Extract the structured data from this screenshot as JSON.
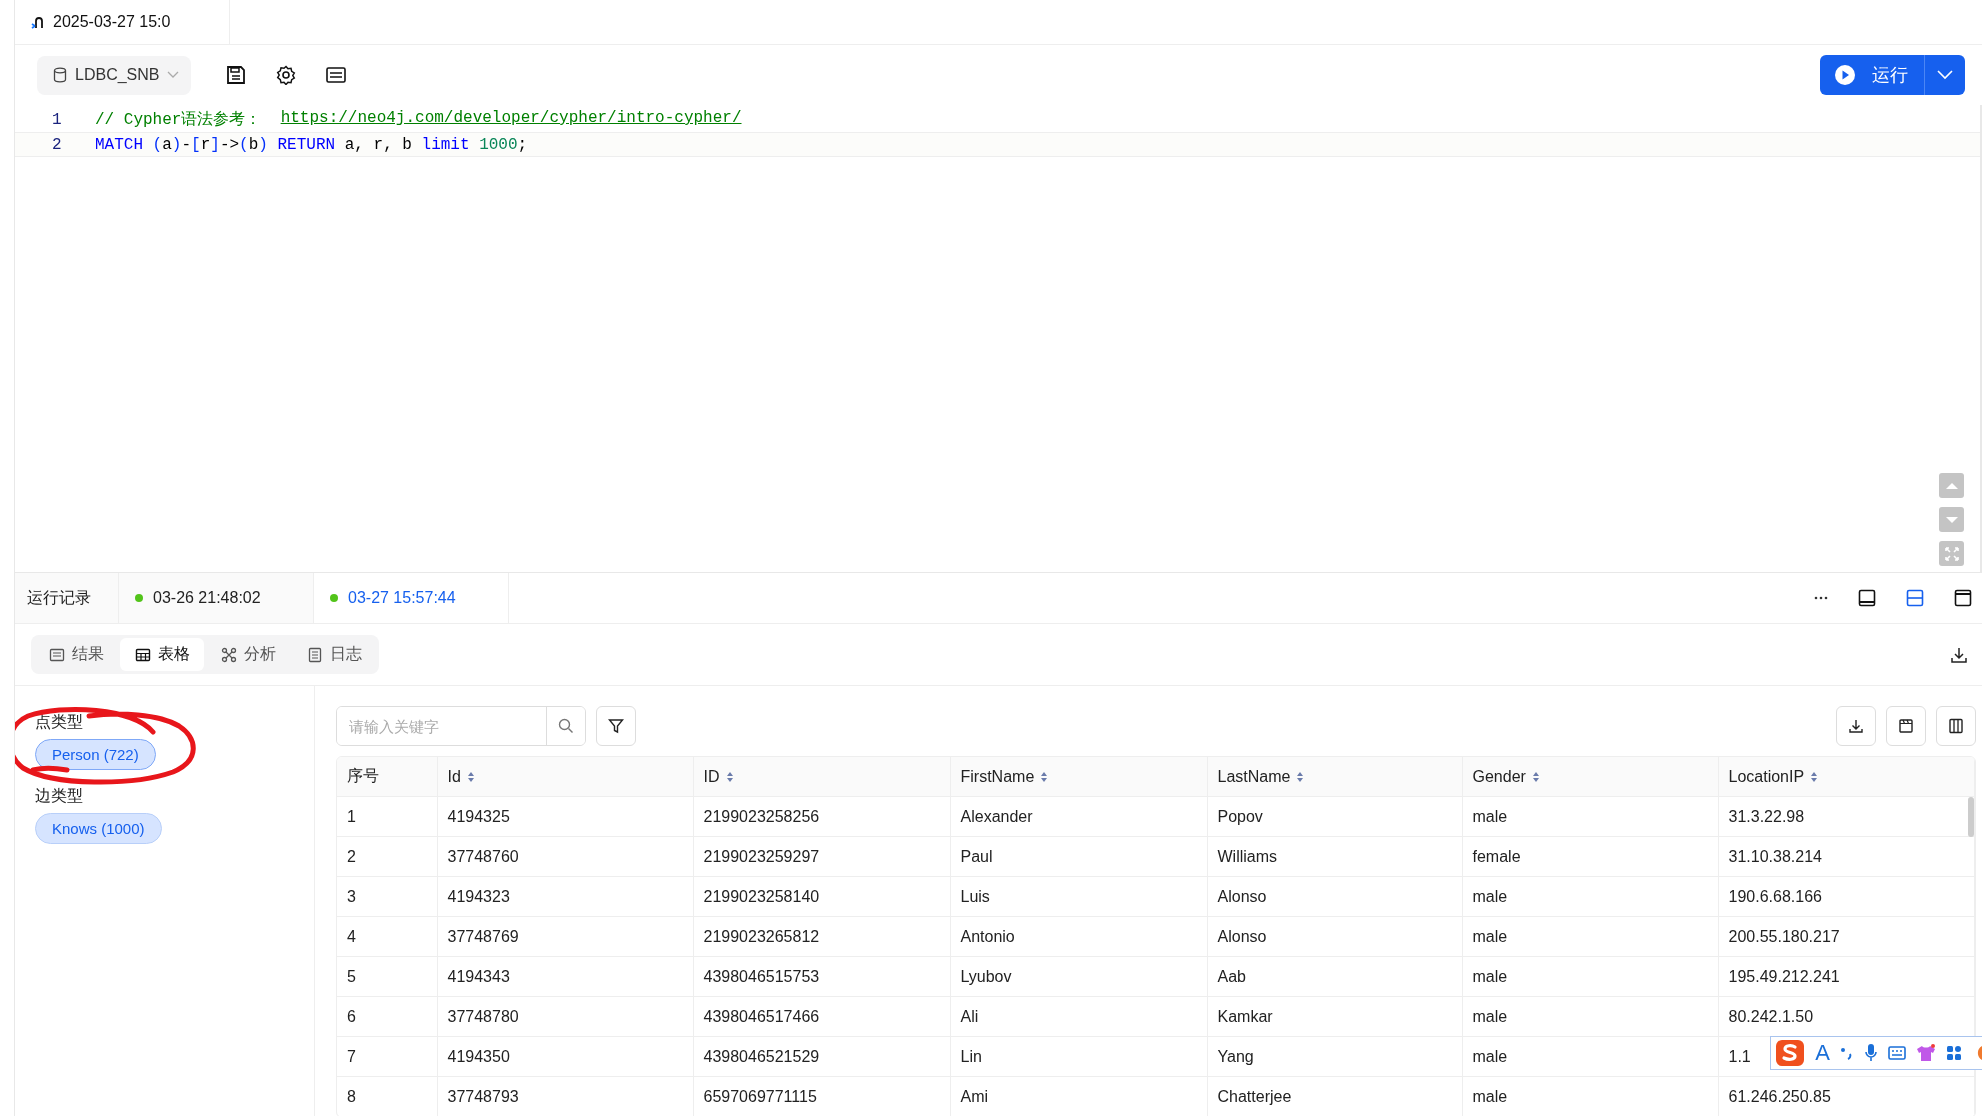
{
  "tab": {
    "title": "2025-03-27 15:0"
  },
  "toolbar": {
    "database": "LDBC_SNB",
    "run_button": "运行"
  },
  "editor": {
    "lines": [
      {
        "number": "1",
        "tokens": [
          {
            "kind": "comment",
            "text": "// Cypher语法参考：  "
          },
          {
            "kind": "link",
            "text": "https://neo4j.com/developer/cypher/intro-cypher/"
          }
        ]
      },
      {
        "number": "2",
        "tokens": [
          {
            "kind": "keyword",
            "text": "MATCH "
          },
          {
            "kind": "bracket",
            "text": "("
          },
          {
            "kind": "plain",
            "text": "a"
          },
          {
            "kind": "bracket",
            "text": ")"
          },
          {
            "kind": "plain",
            "text": "-"
          },
          {
            "kind": "bracket",
            "text": "["
          },
          {
            "kind": "plain",
            "text": "r"
          },
          {
            "kind": "bracket",
            "text": "]"
          },
          {
            "kind": "plain",
            "text": "->"
          },
          {
            "kind": "bracket",
            "text": "("
          },
          {
            "kind": "plain",
            "text": "b"
          },
          {
            "kind": "bracket",
            "text": ")"
          },
          {
            "kind": "keyword",
            "text": " RETURN"
          },
          {
            "kind": "plain",
            "text": " a, r, b "
          },
          {
            "kind": "keyword",
            "text": "limit"
          },
          {
            "kind": "number",
            "text": " 1000"
          },
          {
            "kind": "plain",
            "text": ";"
          }
        ]
      }
    ]
  },
  "history": {
    "label": "运行记录",
    "runs": [
      {
        "time": "03-26 21:48:02",
        "selected": false
      },
      {
        "time": "03-27 15:57:44",
        "selected": true
      }
    ]
  },
  "view_modes": [
    {
      "kind": "bottom",
      "selected": false
    },
    {
      "kind": "split",
      "selected": true
    },
    {
      "kind": "top",
      "selected": false
    }
  ],
  "result_tabs": [
    {
      "kind": "result",
      "label": "结果",
      "selected": false
    },
    {
      "kind": "table",
      "label": "表格",
      "selected": true
    },
    {
      "kind": "analysis",
      "label": "分析",
      "selected": false
    },
    {
      "kind": "log",
      "label": "日志",
      "selected": false
    }
  ],
  "types": {
    "node_label": "点类型",
    "node_types": [
      "Person (722)"
    ],
    "edge_label": "边类型",
    "edge_types": [
      "Knows (1000)"
    ]
  },
  "search": {
    "placeholder": "请输入关键字"
  },
  "table": {
    "columns": [
      {
        "label": "序号",
        "sortable": false
      },
      {
        "label": "Id",
        "sortable": true
      },
      {
        "label": "ID",
        "sortable": true
      },
      {
        "label": "FirstName",
        "sortable": true
      },
      {
        "label": "LastName",
        "sortable": true
      },
      {
        "label": "Gender",
        "sortable": true
      },
      {
        "label": "LocationIP",
        "sortable": true
      }
    ],
    "rows": [
      [
        "1",
        "4194325",
        "2199023258256",
        "Alexander",
        "Popov",
        "male",
        "31.3.22.98"
      ],
      [
        "2",
        "37748760",
        "2199023259297",
        "Paul",
        "Williams",
        "female",
        "31.10.38.214"
      ],
      [
        "3",
        "4194323",
        "2199023258140",
        "Luis",
        "Alonso",
        "male",
        "190.6.68.166"
      ],
      [
        "4",
        "37748769",
        "2199023265812",
        "Antonio",
        "Alonso",
        "male",
        "200.55.180.217"
      ],
      [
        "5",
        "4194343",
        "4398046515753",
        "Lyubov",
        "Aab",
        "male",
        "195.49.212.241"
      ],
      [
        "6",
        "37748780",
        "4398046517466",
        "Ali",
        "Kamkar",
        "male",
        "80.242.1.50"
      ],
      [
        "7",
        "4194350",
        "4398046521529",
        "Lin",
        "Yang",
        "male",
        "1.1"
      ],
      [
        "8",
        "37748793",
        "6597069771115",
        "Ami",
        "Chatterjee",
        "male",
        "61.246.250.85"
      ]
    ]
  },
  "ime_toolbar": {
    "letter": "A"
  }
}
